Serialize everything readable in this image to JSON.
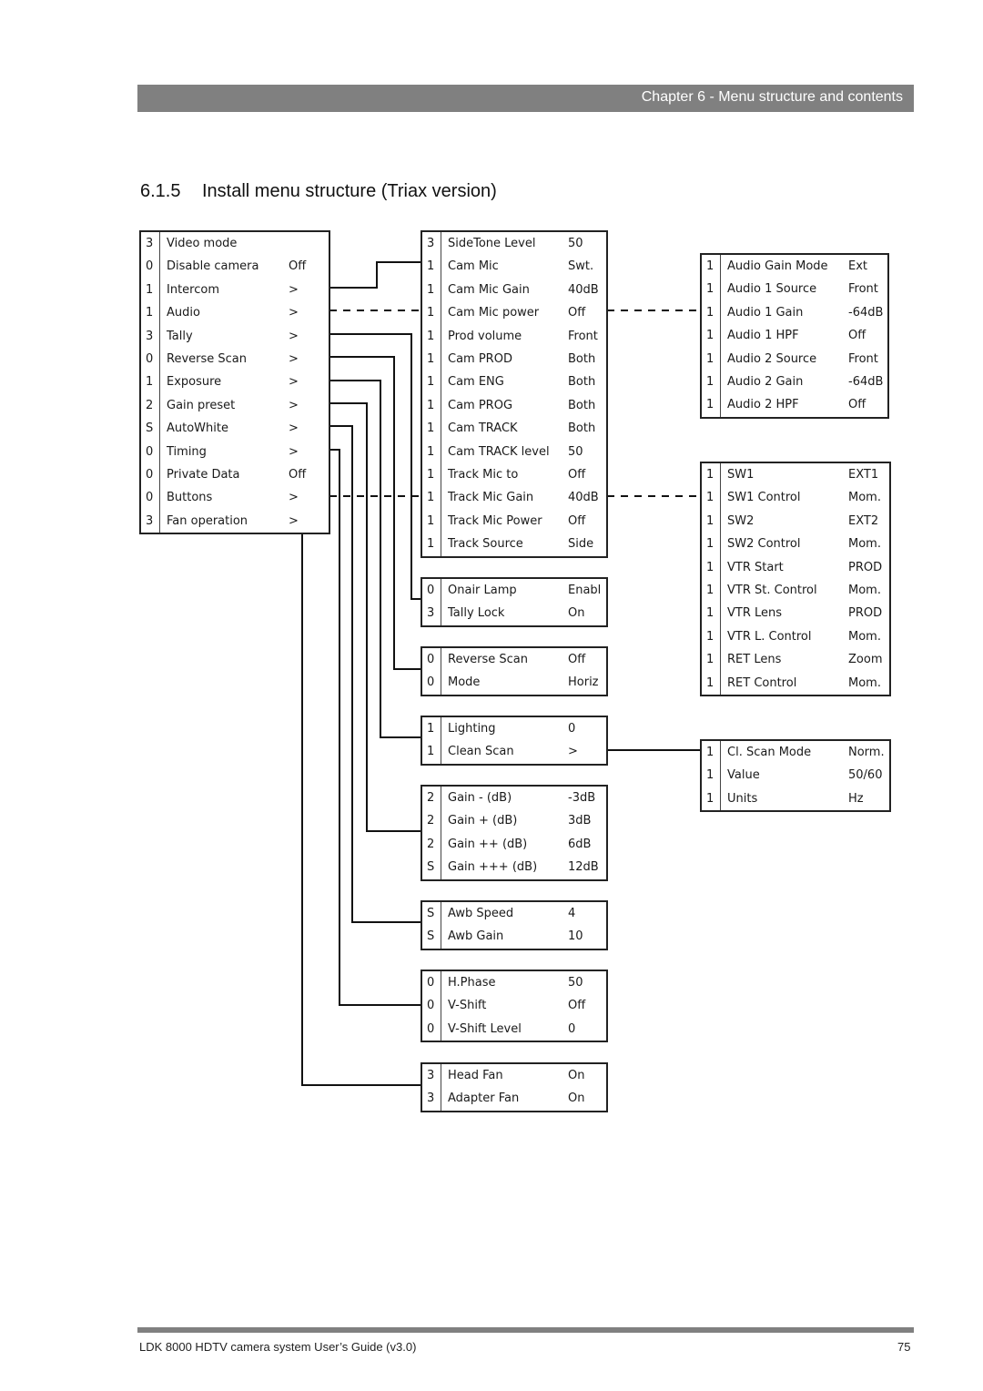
{
  "header": {
    "chapter": "Chapter 6 - Menu structure and contents"
  },
  "section": {
    "number": "6.1.5",
    "title": "Install menu structure (Triax version)"
  },
  "menus": {
    "install": [
      {
        "level": "3",
        "label": "Video mode",
        "value": ""
      },
      {
        "level": "0",
        "label": "Disable camera",
        "value": "Off"
      },
      {
        "level": "1",
        "label": "Intercom",
        "value": ">"
      },
      {
        "level": "1",
        "label": "Audio",
        "value": ">"
      },
      {
        "level": "3",
        "label": "Tally",
        "value": ">"
      },
      {
        "level": "0",
        "label": "Reverse Scan",
        "value": ">"
      },
      {
        "level": "1",
        "label": "Exposure",
        "value": ">"
      },
      {
        "level": "2",
        "label": "Gain preset",
        "value": ">"
      },
      {
        "level": "S",
        "label": "AutoWhite",
        "value": ">"
      },
      {
        "level": "0",
        "label": "Timing",
        "value": ">"
      },
      {
        "level": "0",
        "label": "Private Data",
        "value": "Off"
      },
      {
        "level": "0",
        "label": "Buttons",
        "value": ">"
      },
      {
        "level": "3",
        "label": "Fan operation",
        "value": ">"
      }
    ],
    "intercom": [
      {
        "level": "3",
        "label": "SideTone Level",
        "value": "50"
      },
      {
        "level": "1",
        "label": "Cam Mic",
        "value": "Swt."
      },
      {
        "level": "1",
        "label": "Cam Mic Gain",
        "value": "40dB"
      },
      {
        "level": "1",
        "label": "Cam Mic power",
        "value": "Off"
      },
      {
        "level": "1",
        "label": "Prod volume",
        "value": "Front"
      },
      {
        "level": "1",
        "label": "Cam PROD",
        "value": "Both"
      },
      {
        "level": "1",
        "label": "Cam ENG",
        "value": "Both"
      },
      {
        "level": "1",
        "label": "Cam PROG",
        "value": "Both"
      },
      {
        "level": "1",
        "label": "Cam TRACK",
        "value": "Both"
      },
      {
        "level": "1",
        "label": "Cam TRACK level",
        "value": "50"
      },
      {
        "level": "1",
        "label": "Track Mic to",
        "value": "Off"
      },
      {
        "level": "1",
        "label": "Track Mic Gain",
        "value": "40dB"
      },
      {
        "level": "1",
        "label": "Track Mic Power",
        "value": "Off"
      },
      {
        "level": "1",
        "label": "Track Source",
        "value": "Side"
      }
    ],
    "tally": [
      {
        "level": "0",
        "label": "Onair Lamp",
        "value": "Enabl"
      },
      {
        "level": "3",
        "label": "Tally Lock",
        "value": "On"
      }
    ],
    "reverse_scan": [
      {
        "level": "0",
        "label": "Reverse Scan",
        "value": "Off"
      },
      {
        "level": "0",
        "label": "Mode",
        "value": "Horiz"
      }
    ],
    "exposure": [
      {
        "level": "1",
        "label": "Lighting",
        "value": "0"
      },
      {
        "level": "1",
        "label": "Clean Scan",
        "value": ">"
      }
    ],
    "gain_preset": [
      {
        "level": "2",
        "label": "Gain - (dB)",
        "value": "-3dB"
      },
      {
        "level": "2",
        "label": "Gain + (dB)",
        "value": "3dB"
      },
      {
        "level": "2",
        "label": "Gain ++ (dB)",
        "value": "6dB"
      },
      {
        "level": "S",
        "label": "Gain +++ (dB)",
        "value": "12dB"
      }
    ],
    "autowhite": [
      {
        "level": "S",
        "label": "Awb Speed",
        "value": "4"
      },
      {
        "level": "S",
        "label": "Awb Gain",
        "value": "10"
      }
    ],
    "timing": [
      {
        "level": "0",
        "label": "H.Phase",
        "value": "50"
      },
      {
        "level": "0",
        "label": "V-Shift",
        "value": "Off"
      },
      {
        "level": "0",
        "label": "V-Shift Level",
        "value": "0"
      }
    ],
    "fan": [
      {
        "level": "3",
        "label": "Head Fan",
        "value": "On"
      },
      {
        "level": "3",
        "label": "Adapter Fan",
        "value": "On"
      }
    ],
    "audio": [
      {
        "level": "1",
        "label": "Audio Gain Mode",
        "value": "Ext"
      },
      {
        "level": "1",
        "label": "Audio 1 Source",
        "value": "Front"
      },
      {
        "level": "1",
        "label": "Audio 1 Gain",
        "value": "-64dB"
      },
      {
        "level": "1",
        "label": "Audio 1 HPF",
        "value": "Off"
      },
      {
        "level": "1",
        "label": "Audio 2 Source",
        "value": "Front"
      },
      {
        "level": "1",
        "label": "Audio 2 Gain",
        "value": "-64dB"
      },
      {
        "level": "1",
        "label": "Audio 2 HPF",
        "value": "Off"
      }
    ],
    "buttons": [
      {
        "level": "1",
        "label": "SW1",
        "value": "EXT1"
      },
      {
        "level": "1",
        "label": "SW1 Control",
        "value": "Mom."
      },
      {
        "level": "1",
        "label": "SW2",
        "value": "EXT2"
      },
      {
        "level": "1",
        "label": "SW2 Control",
        "value": "Mom."
      },
      {
        "level": "1",
        "label": "VTR Start",
        "value": "PROD"
      },
      {
        "level": "1",
        "label": "VTR St. Control",
        "value": "Mom."
      },
      {
        "level": "1",
        "label": "VTR Lens",
        "value": "PROD"
      },
      {
        "level": "1",
        "label": "VTR L. Control",
        "value": "Mom."
      },
      {
        "level": "1",
        "label": "RET Lens",
        "value": "Zoom"
      },
      {
        "level": "1",
        "label": "RET Control",
        "value": "Mom."
      }
    ],
    "clean_scan": [
      {
        "level": "1",
        "label": "Cl. Scan Mode",
        "value": "Norm."
      },
      {
        "level": "1",
        "label": "Value",
        "value": "50/60"
      },
      {
        "level": "1",
        "label": "Units",
        "value": "Hz"
      }
    ]
  },
  "footer": {
    "title": "LDK 8000 HDTV camera system User’s Guide (v3.0)",
    "page": "75"
  }
}
